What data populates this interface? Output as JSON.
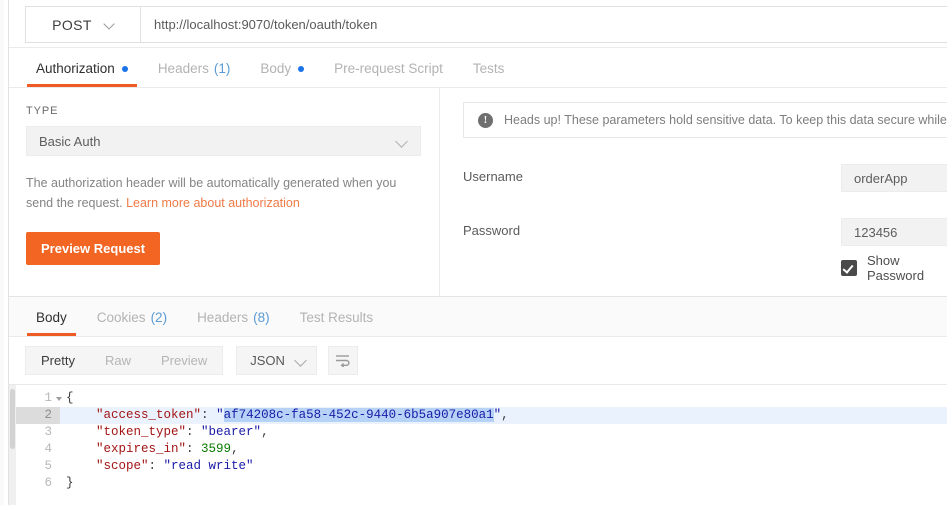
{
  "request": {
    "method": "POST",
    "method_caret_icon": "chevron-down-icon",
    "url": "http://localhost:9070/token/oauth/token"
  },
  "request_tabs": [
    {
      "label": "Authorization",
      "active": true,
      "dot": true,
      "count": ""
    },
    {
      "label": "Headers",
      "active": false,
      "dot": false,
      "count": "(1)"
    },
    {
      "label": "Body",
      "active": false,
      "dot": true,
      "count": ""
    },
    {
      "label": "Pre-request Script",
      "active": false,
      "dot": false,
      "count": ""
    },
    {
      "label": "Tests",
      "active": false,
      "dot": false,
      "count": ""
    }
  ],
  "authorization": {
    "type_label": "TYPE",
    "type_value": "Basic Auth",
    "type_caret_icon": "chevron-down-icon",
    "help_text": "The authorization header will be automatically generated when you send the request. ",
    "help_link": "Learn more about authorization",
    "preview_button": "Preview Request",
    "notice": {
      "icon": "info-icon",
      "glyph": "!",
      "text": "Heads up! These parameters hold sensitive data. To keep this data secure while wo"
    },
    "fields": [
      {
        "label": "Username",
        "value": "orderApp"
      },
      {
        "label": "Password",
        "value": "123456"
      }
    ],
    "show_password": {
      "label": "Show Password",
      "checked": true
    }
  },
  "response_tabs": [
    {
      "label": "Body",
      "active": true,
      "count": ""
    },
    {
      "label": "Cookies",
      "active": false,
      "count": "(2)"
    },
    {
      "label": "Headers",
      "active": false,
      "count": "(8)"
    },
    {
      "label": "Test Results",
      "active": false,
      "count": ""
    }
  ],
  "response_toolbar": {
    "view_modes": [
      {
        "label": "Pretty",
        "active": true
      },
      {
        "label": "Raw",
        "active": false
      },
      {
        "label": "Preview",
        "active": false
      }
    ],
    "language": "JSON",
    "language_caret_icon": "chevron-down-icon",
    "wrap_icon": "word-wrap-icon"
  },
  "response_body": {
    "lines": [
      {
        "number": "1",
        "foldable": true,
        "highlight": false,
        "tokens": [
          {
            "t": "{",
            "c": "tok-punct"
          }
        ]
      },
      {
        "number": "2",
        "foldable": false,
        "highlight": true,
        "tokens": [
          {
            "t": "    ",
            "c": ""
          },
          {
            "t": "\"access_token\"",
            "c": "tok-key"
          },
          {
            "t": ": ",
            "c": "tok-punct"
          },
          {
            "t": "\"",
            "c": "tok-str"
          },
          {
            "t": "af74208c-fa58-452c-9440-6b5a907e80a1",
            "c": "tok-sel"
          },
          {
            "t": "\"",
            "c": "tok-str"
          },
          {
            "t": ",",
            "c": "tok-punct"
          }
        ]
      },
      {
        "number": "3",
        "foldable": false,
        "highlight": false,
        "tokens": [
          {
            "t": "    ",
            "c": ""
          },
          {
            "t": "\"token_type\"",
            "c": "tok-key"
          },
          {
            "t": ": ",
            "c": "tok-punct"
          },
          {
            "t": "\"bearer\"",
            "c": "tok-str"
          },
          {
            "t": ",",
            "c": "tok-punct"
          }
        ]
      },
      {
        "number": "4",
        "foldable": false,
        "highlight": false,
        "tokens": [
          {
            "t": "    ",
            "c": ""
          },
          {
            "t": "\"expires_in\"",
            "c": "tok-key"
          },
          {
            "t": ": ",
            "c": "tok-punct"
          },
          {
            "t": "3599",
            "c": "tok-num"
          },
          {
            "t": ",",
            "c": "tok-punct"
          }
        ]
      },
      {
        "number": "5",
        "foldable": false,
        "highlight": false,
        "tokens": [
          {
            "t": "    ",
            "c": ""
          },
          {
            "t": "\"scope\"",
            "c": "tok-key"
          },
          {
            "t": ": ",
            "c": "tok-punct"
          },
          {
            "t": "\"read write\"",
            "c": "tok-str"
          }
        ]
      },
      {
        "number": "6",
        "foldable": false,
        "highlight": false,
        "tokens": [
          {
            "t": "}",
            "c": "tok-punct"
          }
        ]
      }
    ]
  },
  "colors": {
    "accent": "#f26522",
    "tab_underline": "#ef5b25",
    "link": "#ef7a45",
    "count_badge": "#5b9bd5",
    "dot": "#1a73e8",
    "selection": "#b6d2f7",
    "active_line": "#eaf2fd"
  }
}
